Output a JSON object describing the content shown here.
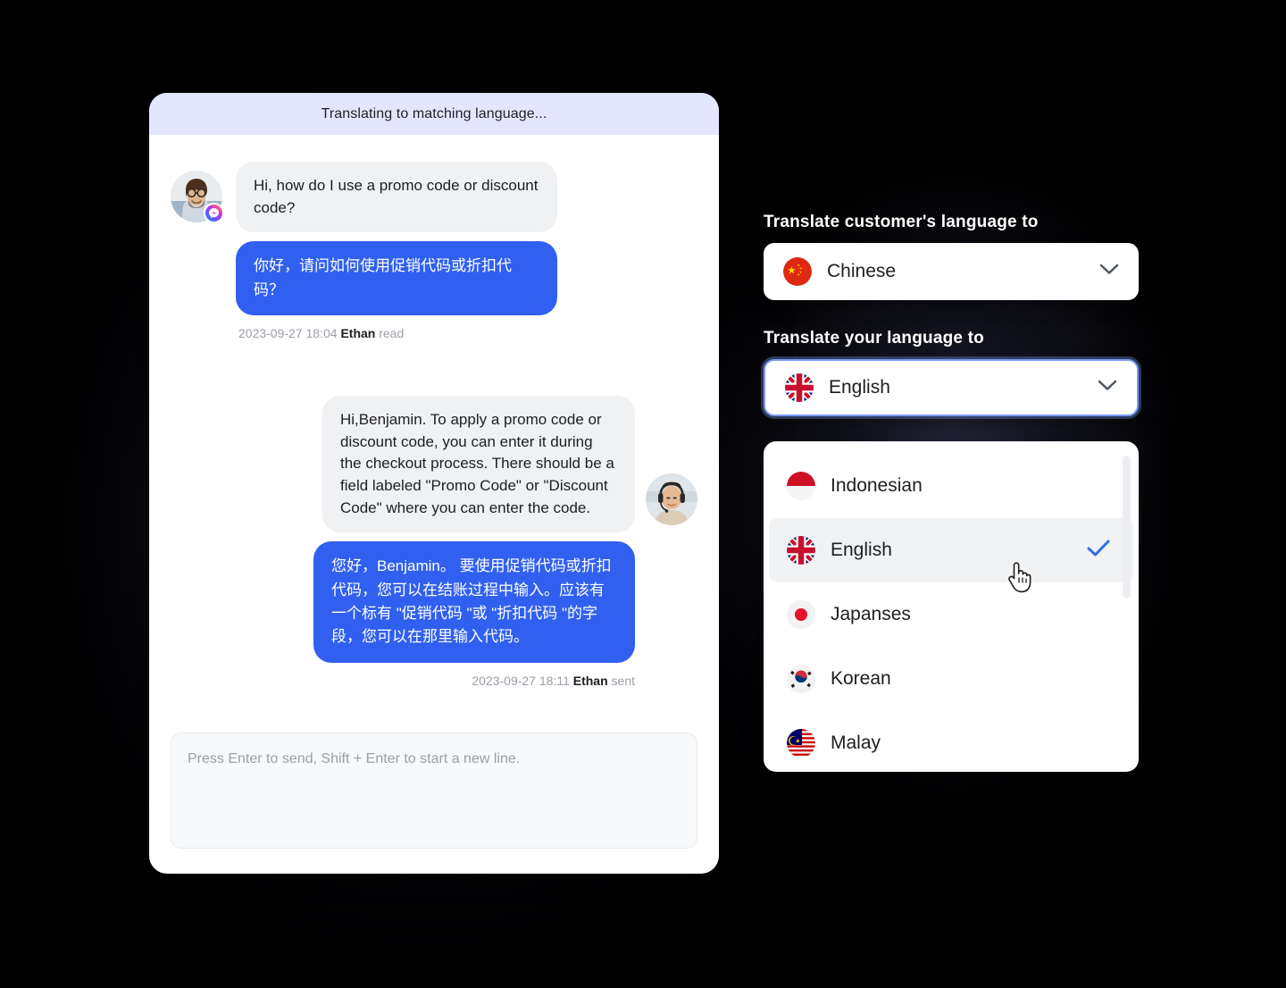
{
  "chat": {
    "header_status": "Translating to matching language...",
    "messages": [
      {
        "id": "customer-question",
        "side": "incoming",
        "avatar_name": "customer-avatar",
        "channel_badge": "messenger-badge",
        "original": "Hi, how do I use a promo code or discount code?",
        "translated": "你好，请问如何使用促销代码或折扣代码？",
        "timestamp": "2023-09-27 18:04",
        "sender": "Ethan",
        "status": "read"
      },
      {
        "id": "agent-reply",
        "side": "outgoing",
        "avatar_name": "agent-avatar",
        "original": "Hi,Benjamin. To apply a promo code or discount code, you can enter it during the checkout process. There should be a field labeled \"Promo Code\" or \"Discount Code\" where you can enter the code.",
        "translated": "您好，Benjamin。 要使用促销代码或折扣代码，您可以在结账过程中输入。应该有一个标有 \"促销代码 \"或 \"折扣代码 \"的字段，您可以在那里输入代码。",
        "timestamp": "2023-09-27 18:11",
        "sender": "Ethan",
        "status": "sent"
      }
    ],
    "composer": {
      "placeholder": "Press Enter to send,  Shift + Enter to start a new line.",
      "value": ""
    }
  },
  "settings": {
    "customer_language": {
      "label": "Translate customer's language to",
      "selected": "Chinese",
      "flag": "flag-china",
      "chevron": "chevron-down-icon"
    },
    "your_language": {
      "label": "Translate your language to",
      "selected": "English",
      "flag": "flag-uk",
      "chevron": "chevron-down-icon",
      "focused": true
    },
    "dropdown": {
      "options": [
        {
          "label": "Indonesian",
          "flag": "flag-indonesia",
          "selected": false
        },
        {
          "label": "English",
          "flag": "flag-uk",
          "selected": true
        },
        {
          "label": "Japanses",
          "flag": "flag-japan",
          "selected": false
        },
        {
          "label": "Korean",
          "flag": "flag-korea",
          "selected": false
        },
        {
          "label": "Malay",
          "flag": "flag-malaysia",
          "selected": false
        }
      ],
      "check_icon": "check-icon",
      "scrollbar": "dropdown-scrollbar"
    }
  },
  "colors": {
    "accent_blue": "#3160f0",
    "header_band": "#e3e7fd",
    "bubble_gray": "#f0f1f3",
    "focus_ring": "#7e9bf5",
    "page_background": "#000000"
  },
  "cursor": {
    "type": "pointing-hand-cursor"
  }
}
